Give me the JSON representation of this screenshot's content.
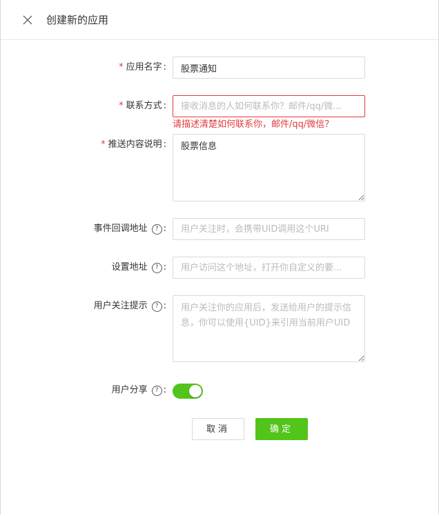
{
  "header": {
    "title": "创建新的应用",
    "close_icon": "close-icon"
  },
  "form": {
    "app_name": {
      "required": true,
      "label": "应用名字",
      "value": "股票通知"
    },
    "contact": {
      "required": true,
      "label": "联系方式",
      "placeholder": "接收消息的人如何联系你？邮件/qq/微...",
      "error": "请描述清楚如何联系你，邮件/qq/微信？"
    },
    "push_desc": {
      "required": true,
      "label": "推送内容说明",
      "value": "股票信息"
    },
    "callback_url": {
      "label": "事件回调地址",
      "placeholder": "用户关注时，会携带UID调用这个URI",
      "help_icon": "question-circle-icon"
    },
    "settings_url": {
      "label": "设置地址",
      "placeholder": "用户访问这个地址，打开你自定义的要...",
      "help_icon": "question-circle-icon"
    },
    "follow_tip": {
      "label": "用户关注提示",
      "placeholder": "用户关注你的应用后，发送给用户的提示信息，你可以使用{UID}来引用当前用户UID",
      "help_icon": "question-circle-icon"
    },
    "user_share": {
      "label": "用户分享",
      "enabled": true,
      "help_icon": "question-circle-icon"
    }
  },
  "buttons": {
    "cancel": "取消",
    "ok": "确定"
  },
  "colors": {
    "accent": "#52c41a",
    "error": "#e4393c",
    "border": "#d9d9d9"
  },
  "symbols": {
    "required_mark": "*",
    "colon": ":",
    "help_glyph": "?"
  }
}
